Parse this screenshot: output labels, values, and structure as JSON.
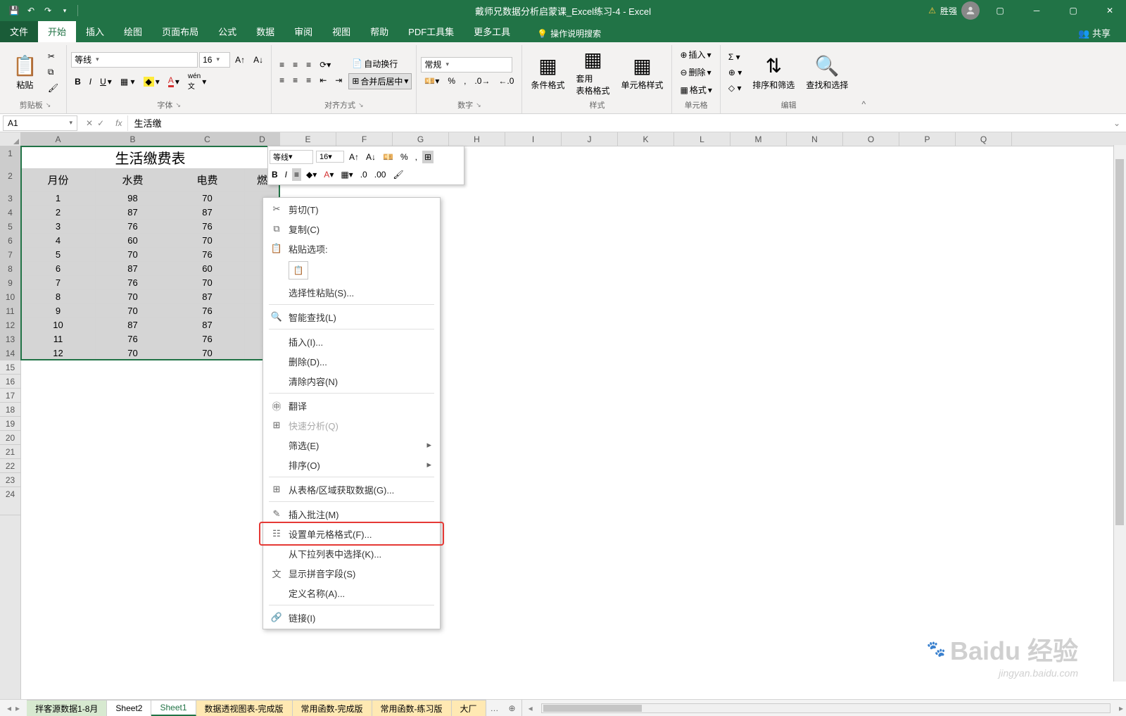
{
  "title": "戴师兄数据分析启蒙课_Excel练习-4  -  Excel",
  "user": "胜强",
  "tabs": [
    "文件",
    "开始",
    "插入",
    "绘图",
    "页面布局",
    "公式",
    "数据",
    "审阅",
    "视图",
    "帮助",
    "PDF工具集",
    "更多工具"
  ],
  "active_tab": 1,
  "tell_me": "操作说明搜索",
  "share": "共享",
  "ribbon": {
    "clipboard": {
      "paste": "粘贴",
      "label": "剪贴板"
    },
    "font": {
      "name": "等线",
      "size": "16",
      "label": "字体"
    },
    "align": {
      "wrap": "自动换行",
      "merge": "合并后居中",
      "label": "对齐方式"
    },
    "number": {
      "format": "常规",
      "label": "数字"
    },
    "styles": {
      "cond": "条件格式",
      "table": "套用\n表格格式",
      "cell": "单元格样式",
      "label": "样式"
    },
    "cells": {
      "insert": "插入",
      "delete": "删除",
      "format": "格式",
      "label": "单元格"
    },
    "editing": {
      "sort": "排序和筛选",
      "find": "查找和选择",
      "label": "编辑"
    }
  },
  "namebox": "A1",
  "formula": "生活缴",
  "mini": {
    "font": "等线",
    "size": "16"
  },
  "columns": [
    "A",
    "B",
    "C",
    "D",
    "E",
    "F",
    "G",
    "H",
    "I",
    "J",
    "K",
    "L",
    "M",
    "N",
    "O",
    "P",
    "Q"
  ],
  "col_widths": {
    "A": 106,
    "B": 106,
    "C": 106,
    "D": 50
  },
  "rows": [
    1,
    2,
    3,
    4,
    5,
    6,
    7,
    8,
    9,
    10,
    11,
    12,
    13,
    14,
    15,
    16,
    17,
    18,
    19,
    20,
    21,
    22,
    23,
    24
  ],
  "row_heights": {
    "1": 32,
    "2": 32,
    "24": 40
  },
  "merged_title": "生活缴费表",
  "headers": [
    "月份",
    "水费",
    "电费",
    "燃"
  ],
  "data": [
    [
      "1",
      "98",
      "70"
    ],
    [
      "2",
      "87",
      "87"
    ],
    [
      "3",
      "76",
      "76"
    ],
    [
      "4",
      "60",
      "70"
    ],
    [
      "5",
      "70",
      "76"
    ],
    [
      "6",
      "87",
      "60"
    ],
    [
      "7",
      "76",
      "70"
    ],
    [
      "8",
      "70",
      "87"
    ],
    [
      "9",
      "70",
      "76"
    ],
    [
      "10",
      "87",
      "87"
    ],
    [
      "11",
      "76",
      "76"
    ],
    [
      "12",
      "70",
      "70"
    ]
  ],
  "context_menu": [
    {
      "icon": "✂",
      "label": "剪切(T)"
    },
    {
      "icon": "⧉",
      "label": "复制(C)"
    },
    {
      "icon": "📋",
      "label": "粘贴选项:",
      "opts": true
    },
    {
      "label": "选择性粘贴(S)..."
    },
    {
      "sep": true
    },
    {
      "icon": "🔍",
      "label": "智能查找(L)"
    },
    {
      "sep": true
    },
    {
      "label": "插入(I)..."
    },
    {
      "label": "删除(D)..."
    },
    {
      "label": "清除内容(N)"
    },
    {
      "sep": true
    },
    {
      "icon": "㊥",
      "label": "翻译"
    },
    {
      "icon": "⊞",
      "label": "快速分析(Q)",
      "disabled": true
    },
    {
      "label": "筛选(E)",
      "sub": true
    },
    {
      "label": "排序(O)",
      "sub": true
    },
    {
      "sep": true
    },
    {
      "icon": "⊞",
      "label": "从表格/区域获取数据(G)..."
    },
    {
      "sep": true
    },
    {
      "icon": "✎",
      "label": "插入批注(M)"
    },
    {
      "icon": "☷",
      "label": "设置单元格格式(F)...",
      "redbox": true
    },
    {
      "label": "从下拉列表中选择(K)..."
    },
    {
      "icon": "文",
      "label": "显示拼音字段(S)"
    },
    {
      "label": "定义名称(A)..."
    },
    {
      "sep": true
    },
    {
      "icon": "🔗",
      "label": "链接(I)"
    }
  ],
  "sheets": [
    {
      "name": "拌客源数据1-8月",
      "cls": "color1"
    },
    {
      "name": "Sheet2",
      "cls": ""
    },
    {
      "name": "Sheet1",
      "cls": "active"
    },
    {
      "name": "数据透视图表-完成版",
      "cls": "color2"
    },
    {
      "name": "常用函数-完成版",
      "cls": "color2"
    },
    {
      "name": "常用函数-练习版",
      "cls": "color2"
    },
    {
      "name": "大厂",
      "cls": "color2"
    }
  ],
  "watermark": {
    "main": "Baidu 经验",
    "sub": "jingyan.baidu.com"
  }
}
